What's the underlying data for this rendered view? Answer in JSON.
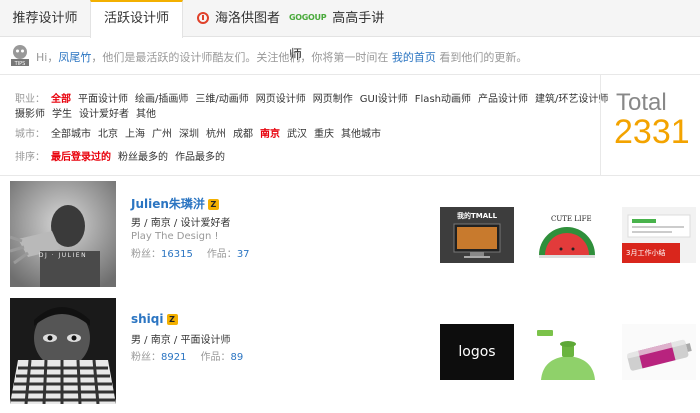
{
  "tabs": [
    {
      "label": "推荐设计师",
      "icon": ""
    },
    {
      "label": "活跃设计师",
      "icon": "",
      "active": true
    },
    {
      "label": "海洛供图者",
      "icon": "huaban-icon"
    },
    {
      "label": "高高手讲师",
      "icon": "gogo-icon",
      "icon_text": "GOGOUP"
    }
  ],
  "tip": {
    "icon_text": "TIPS",
    "greeting": "Hi，",
    "user": "凤尾竹",
    "text": "，他们是最活跃的设计师酷友们。关注他们，你将第一时间在",
    "link": "我的首页",
    "text_after": "看到他们的更新。"
  },
  "filters": {
    "occupation": {
      "label": "职业：",
      "items": [
        "全部",
        "平面设计师",
        "绘画/插画师",
        "三维/动画师",
        "网页设计师",
        "网页制作",
        "GUI设计师",
        "Flash动画师",
        "产品设计师",
        "建筑/环艺设计师"
      ],
      "items_line2": [
        "摄影师",
        "学生",
        "设计爱好者",
        "其他"
      ],
      "active": "全部"
    },
    "city": {
      "label": "城市：",
      "items": [
        "全部城市",
        "北京",
        "上海",
        "广州",
        "深圳",
        "杭州",
        "成都",
        "南京",
        "武汉",
        "重庆",
        "其他城市"
      ],
      "active": "南京"
    },
    "sort": {
      "label": "排序：",
      "items": [
        "最后登录过的",
        "粉丝最多的",
        "作品最多的"
      ],
      "active": "最后登录过的"
    }
  },
  "total": {
    "label": "Total",
    "value": "2331"
  },
  "designers": [
    {
      "name": "Julien朱璘洴",
      "badge": "Z",
      "info": "男 / 南京 / 设计爱好者",
      "slogan": "Play The Design !",
      "fans_label": "粉丝：",
      "fans": "16315",
      "works_label": "作品：",
      "works": "37",
      "avatar_caption": "DJ · JULIEN",
      "thumbs": [
        "我的TMALL",
        "CUTE LIFE",
        "3月工作小结"
      ]
    },
    {
      "name": "shiqi",
      "badge": "Z",
      "info": "男 / 南京 / 平面设计师",
      "slogan": "",
      "fans_label": "粉丝：",
      "fans": "8921",
      "works_label": "作品：",
      "works": "89",
      "thumbs": [
        "logos",
        "",
        ""
      ]
    }
  ],
  "colors": {
    "accent": "#f3b000",
    "link": "#2b75c2",
    "active": "#e8000b",
    "total": "#f3a300"
  }
}
